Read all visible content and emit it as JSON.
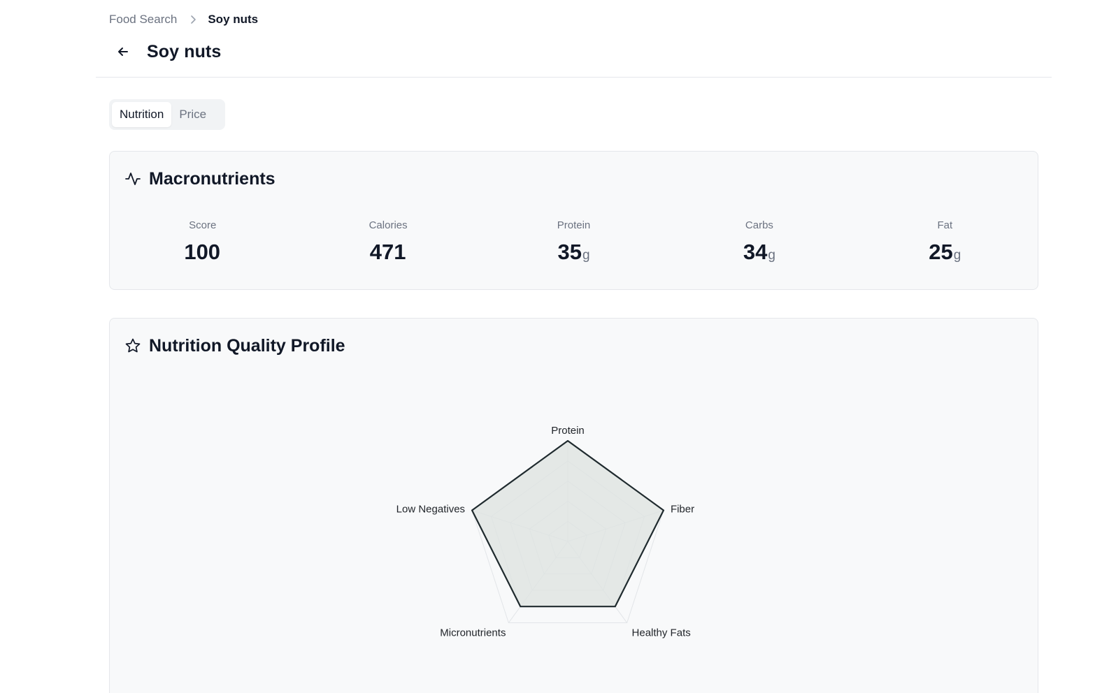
{
  "breadcrumb": {
    "parent": "Food Search",
    "current": "Soy nuts"
  },
  "header": {
    "title": "Soy nuts",
    "back_icon": "arrow-left-icon"
  },
  "tabs": [
    {
      "label": "Nutrition",
      "active": true
    },
    {
      "label": "Price",
      "active": false
    }
  ],
  "macronutrients": {
    "title": "Macronutrients",
    "icon": "activity-icon",
    "stats": [
      {
        "label": "Score",
        "value": "100",
        "unit": ""
      },
      {
        "label": "Calories",
        "value": "471",
        "unit": ""
      },
      {
        "label": "Protein",
        "value": "35",
        "unit": "g"
      },
      {
        "label": "Carbs",
        "value": "34",
        "unit": "g"
      },
      {
        "label": "Fat",
        "value": "25",
        "unit": "g"
      }
    ]
  },
  "quality_profile": {
    "title": "Nutrition Quality Profile",
    "icon": "star-icon"
  },
  "chart_data": {
    "type": "radar",
    "title": "",
    "axes": [
      "Protein",
      "Fiber",
      "Healthy Fats",
      "Micronutrients",
      "Low Negatives"
    ],
    "series": [
      {
        "values": [
          100,
          100,
          80,
          80,
          100
        ]
      }
    ],
    "range": [
      0,
      100
    ],
    "grid_levels": 5,
    "colors": {
      "stroke": "#1f2a2e",
      "fill": "#dfe3e1",
      "grid": "#e2e5e8"
    }
  },
  "colors": {
    "page_bg": "#ffffff",
    "card_bg": "#f8f9fa",
    "border": "#e5e7eb",
    "text_primary": "#111827",
    "text_muted": "#6b7280"
  }
}
